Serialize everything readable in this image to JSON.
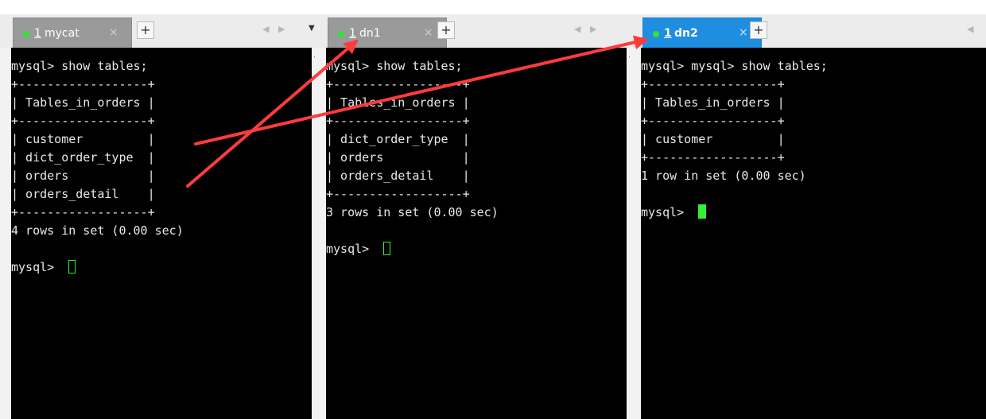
{
  "panes": [
    {
      "tab": {
        "num": "1",
        "name": "mycat",
        "active": false,
        "close": "×",
        "plus": "+"
      },
      "nav": "◀ ▶",
      "dropdown": "▼",
      "lines": [
        "mysql> show tables;",
        "+------------------+",
        "| Tables_in_orders |",
        "+------------------+",
        "| customer         |",
        "| dict_order_type  |",
        "| orders           |",
        "| orders_detail    |",
        "+------------------+",
        "4 rows in set (0.00 sec)",
        "",
        "mysql> "
      ],
      "cursor": "outline"
    },
    {
      "tab": {
        "num": "1",
        "name": "dn1",
        "active": false,
        "close": "×",
        "plus": "+"
      },
      "nav": "◀ ▶",
      "lines": [
        "mysql> show tables;",
        "+------------------+",
        "| Tables_in_orders |",
        "+------------------+",
        "| dict_order_type  |",
        "| orders           |",
        "| orders_detail    |",
        "+------------------+",
        "3 rows in set (0.00 sec)",
        "",
        "mysql> "
      ],
      "cursor": "outline"
    },
    {
      "tab": {
        "num": "1",
        "name": "dn2",
        "active": true,
        "close": "×",
        "plus": "+"
      },
      "nav": "◀",
      "lines": [
        "mysql> mysql> show tables;",
        "+------------------+",
        "| Tables_in_orders |",
        "+------------------+",
        "| customer         |",
        "+------------------+",
        "1 row in set (0.00 sec)",
        "",
        "mysql> "
      ],
      "cursor": "solid"
    }
  ],
  "colors": {
    "active_tab": "#1f8de0",
    "inactive_tab": "#9a9a9a",
    "status_dot": "#34e234",
    "cursor": "#35ef35",
    "annotation_arrow": "#ff3b3b"
  }
}
